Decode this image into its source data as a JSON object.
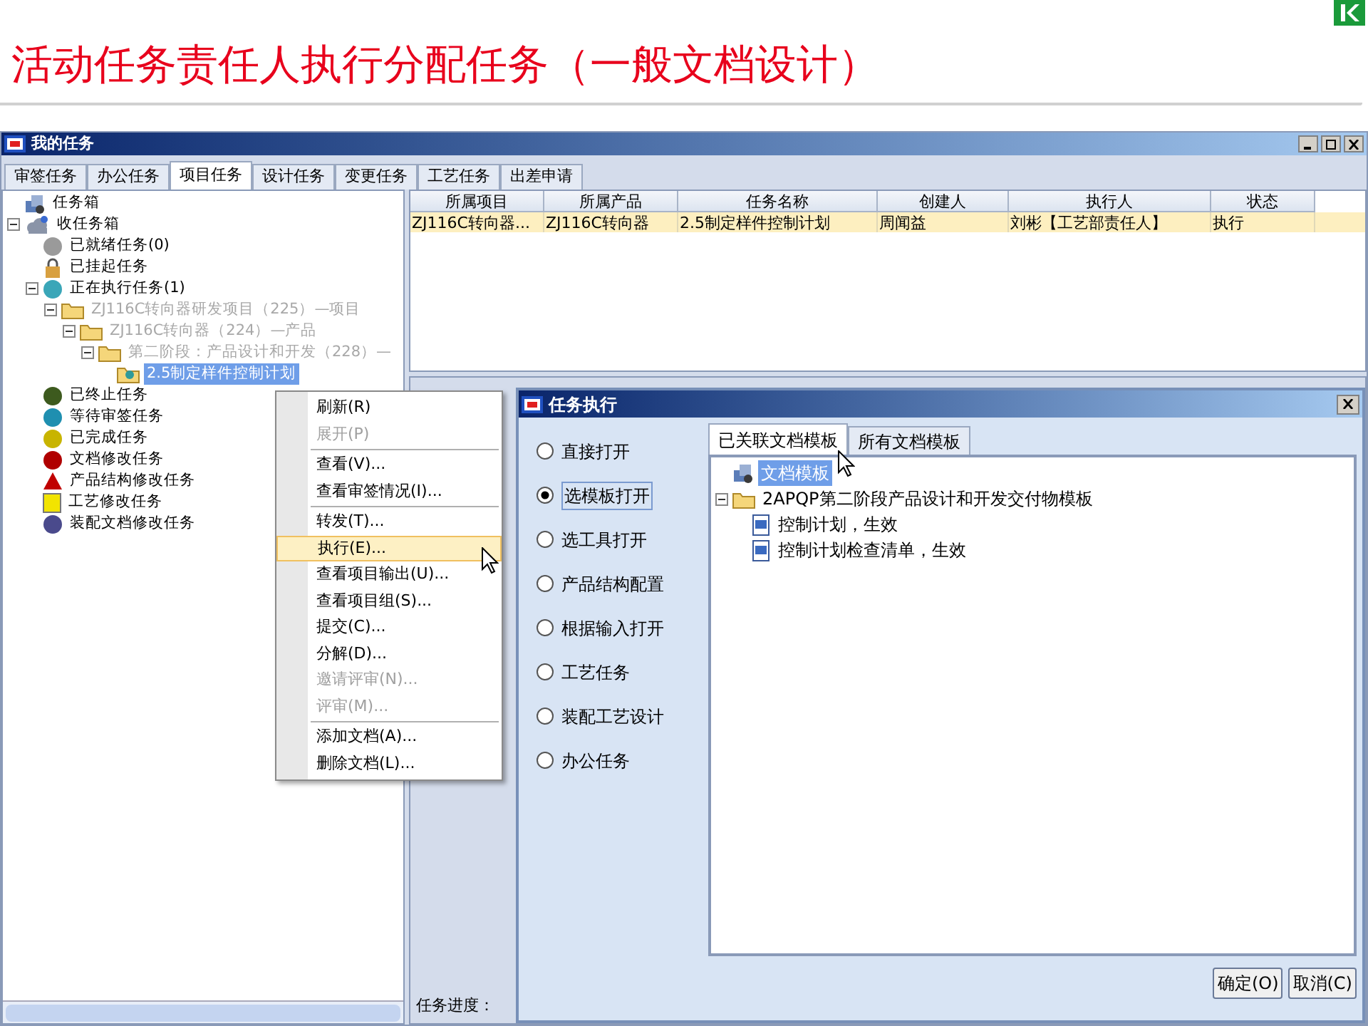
{
  "slide_title": "活动任务责任人执行分配任务（一般文档设计）",
  "window": {
    "title": "我的任务"
  },
  "tabs": [
    {
      "label": "审签任务",
      "selected": false
    },
    {
      "label": "办公任务",
      "selected": false
    },
    {
      "label": "项目任务",
      "selected": true
    },
    {
      "label": "设计任务",
      "selected": false
    },
    {
      "label": "变更任务",
      "selected": false
    },
    {
      "label": "工艺任务",
      "selected": false
    },
    {
      "label": "出差申请",
      "selected": false
    }
  ],
  "tree": [
    {
      "label": "任务箱",
      "kind": "root",
      "dimmed": false,
      "selected": false
    },
    {
      "label": "收任务箱",
      "kind": "inbox",
      "expanded": true,
      "dimmed": false,
      "selected": false,
      "children": [
        {
          "label": "已就绪任务(0)",
          "kind": "ball",
          "color": "#9a9a9a",
          "dimmed": false,
          "selected": false
        },
        {
          "label": "已挂起任务",
          "kind": "lock",
          "dimmed": false,
          "selected": false
        },
        {
          "label": "正在执行任务(1)",
          "kind": "ball",
          "color": "#3aa6b8",
          "expanded": true,
          "dimmed": false,
          "selected": false,
          "children": [
            {
              "label": "ZJ116C转向器研发项目（225）—项目",
              "kind": "folder",
              "expanded": true,
              "dimmed": true,
              "selected": false,
              "children": [
                {
                  "label": "ZJ116C转向器（224）—产品",
                  "kind": "folder",
                  "expanded": true,
                  "dimmed": true,
                  "selected": false,
                  "children": [
                    {
                      "label": "第二阶段：产品设计和开发（228）—",
                      "kind": "folder",
                      "expanded": true,
                      "dimmed": true,
                      "selected": false,
                      "children": [
                        {
                          "label": "2.5制定样件控制计划",
                          "kind": "task",
                          "dimmed": false,
                          "selected": true
                        }
                      ]
                    }
                  ]
                }
              ]
            }
          ]
        },
        {
          "label": "已终止任务",
          "kind": "ball",
          "color": "#3d5a1e",
          "dimmed": false,
          "selected": false
        },
        {
          "label": "等待审签任务",
          "kind": "ball",
          "color": "#1f8fb0",
          "dimmed": false,
          "selected": false
        },
        {
          "label": "已完成任务",
          "kind": "ball",
          "color": "#c8b400",
          "dimmed": false,
          "selected": false
        },
        {
          "label": "文档修改任务",
          "kind": "ball",
          "color": "#b00000",
          "dimmed": false,
          "selected": false
        },
        {
          "label": "产品结构修改任务",
          "kind": "triangle",
          "dimmed": false,
          "selected": false
        },
        {
          "label": "工艺修改任务",
          "kind": "note",
          "dimmed": false,
          "selected": false
        },
        {
          "label": "装配文档修改任务",
          "kind": "ball",
          "color": "#4a4a8c",
          "dimmed": false,
          "selected": false
        }
      ]
    }
  ],
  "table": {
    "columns": [
      "所属项目",
      "所属产品",
      "任务名称",
      "创建人",
      "执行人",
      "状态"
    ],
    "rows": [
      {
        "cells": [
          "ZJ116C转向器...",
          "ZJ116C转向器",
          "2.5制定样件控制计划",
          "周闻益",
          "刘彬【工艺部责任人】",
          "执行"
        ],
        "selected": true
      }
    ]
  },
  "progress_label": "任务进度：",
  "context_menu": [
    {
      "label": "刷新(R)",
      "disabled": false,
      "highlighted": false,
      "separator_before": false
    },
    {
      "label": "展开(P)",
      "disabled": true,
      "highlighted": false,
      "separator_before": false
    },
    {
      "label": "查看(V)...",
      "disabled": false,
      "highlighted": false,
      "separator_before": true
    },
    {
      "label": "查看审签情况(I)...",
      "disabled": false,
      "highlighted": false,
      "separator_before": false
    },
    {
      "label": "转发(T)...",
      "disabled": false,
      "highlighted": false,
      "separator_before": true
    },
    {
      "label": "执行(E)...",
      "disabled": false,
      "highlighted": true,
      "separator_before": false
    },
    {
      "label": "查看项目输出(U)...",
      "disabled": false,
      "highlighted": false,
      "separator_before": false
    },
    {
      "label": "查看项目组(S)...",
      "disabled": false,
      "highlighted": false,
      "separator_before": false
    },
    {
      "label": "提交(C)...",
      "disabled": false,
      "highlighted": false,
      "separator_before": false
    },
    {
      "label": "分解(D)...",
      "disabled": false,
      "highlighted": false,
      "separator_before": false
    },
    {
      "label": "邀请评审(N)...",
      "disabled": true,
      "highlighted": false,
      "separator_before": false
    },
    {
      "label": "评审(M)...",
      "disabled": true,
      "highlighted": false,
      "separator_before": false
    },
    {
      "label": "添加文档(A)...",
      "disabled": false,
      "highlighted": false,
      "separator_before": true
    },
    {
      "label": "删除文档(L)...",
      "disabled": false,
      "highlighted": false,
      "separator_before": false
    }
  ],
  "dialog": {
    "title": "任务执行",
    "options": [
      {
        "label": "直接打开",
        "selected": false
      },
      {
        "label": "选模板打开",
        "selected": true
      },
      {
        "label": "选工具打开",
        "selected": false
      },
      {
        "label": "产品结构配置",
        "selected": false
      },
      {
        "label": "根据输入打开",
        "selected": false
      },
      {
        "label": "工艺任务",
        "selected": false
      },
      {
        "label": "装配工艺设计",
        "selected": false
      },
      {
        "label": "办公任务",
        "selected": false
      }
    ],
    "tabs": [
      {
        "label": "已关联文档模板",
        "selected": true
      },
      {
        "label": "所有文档模板",
        "selected": false
      }
    ],
    "tree": [
      {
        "label": "文档模板",
        "kind": "root",
        "selected": true
      },
      {
        "label": "2APQP第二阶段产品设计和开发交付物模板",
        "kind": "folder",
        "selected": false,
        "expanded": true,
        "children": [
          {
            "label": "控制计划，生效",
            "kind": "doc",
            "selected": false
          },
          {
            "label": "控制计划检查清单，生效",
            "kind": "doc",
            "selected": false
          }
        ]
      }
    ],
    "buttons": [
      "确定(O)",
      "取消(C)"
    ]
  }
}
